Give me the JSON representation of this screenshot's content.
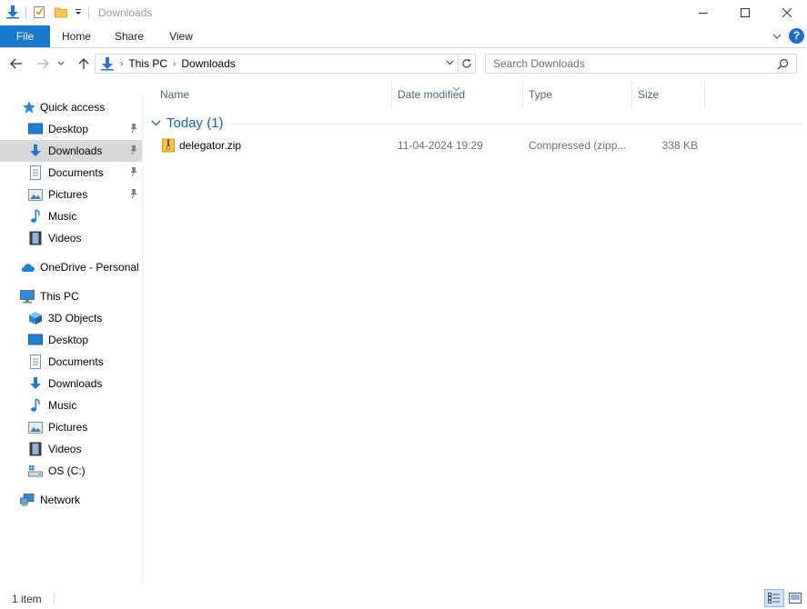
{
  "window": {
    "title": "Downloads"
  },
  "ribbon": {
    "tabs": [
      "File",
      "Home",
      "Share",
      "View"
    ],
    "help": "?"
  },
  "address": {
    "crumbs": [
      "This PC",
      "Downloads"
    ]
  },
  "search": {
    "placeholder": "Search Downloads"
  },
  "navpane": {
    "quick_access": {
      "label": "Quick access",
      "items": [
        "Desktop",
        "Downloads",
        "Documents",
        "Pictures",
        "Music",
        "Videos"
      ]
    },
    "onedrive": "OneDrive - Personal",
    "this_pc": {
      "label": "This PC",
      "items": [
        "3D Objects",
        "Desktop",
        "Documents",
        "Downloads",
        "Music",
        "Pictures",
        "Videos",
        "OS (C:)"
      ]
    },
    "network": "Network"
  },
  "columns": [
    "Name",
    "Date modified",
    "Type",
    "Size"
  ],
  "group": {
    "title": "Today (1)"
  },
  "files": [
    {
      "name": "delegator.zip",
      "date_modified": "11-04-2024 19:29",
      "type": "Compressed (zipp...",
      "size": "338 KB"
    }
  ],
  "status": {
    "item_count": "1 item"
  },
  "colors": {
    "accent": "#1979ca",
    "selected_bg": "#d9d9d9",
    "header_text": "#4c607a"
  }
}
